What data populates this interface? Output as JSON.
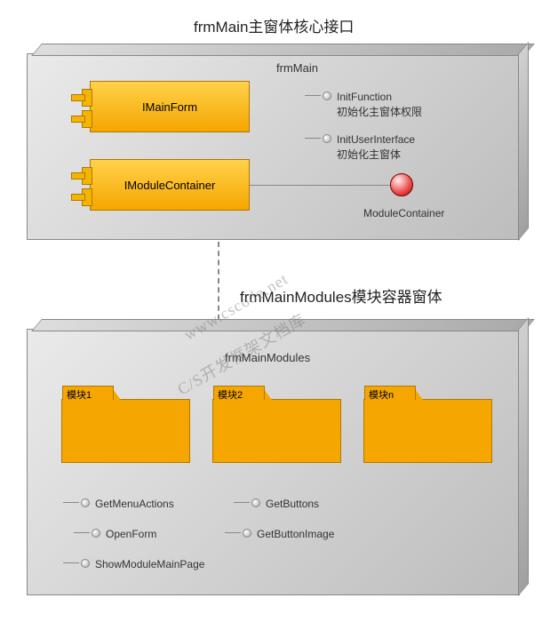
{
  "top": {
    "title": "frmMain主窗体核心接口",
    "subtitle": "frmMain",
    "components": [
      {
        "label": "IMainForm"
      },
      {
        "label": "IModuleContainer"
      }
    ],
    "pins": [
      {
        "name": "InitFunction",
        "desc": "初始化主窗体权限"
      },
      {
        "name": "InitUserInterface",
        "desc": "初始化主窗体"
      }
    ],
    "ball_label": "ModuleContainer"
  },
  "bottom": {
    "title": "frmMainModules模块容器窗体",
    "subtitle": "frmMainModules",
    "folders": [
      {
        "name": "模块1"
      },
      {
        "name": "模块2"
      },
      {
        "name": "模块n"
      }
    ],
    "pins_left": [
      "GetMenuActions",
      "OpenForm",
      "ShowModuleMainPage"
    ],
    "pins_right": [
      "GetButtons",
      "GetButtonImage"
    ]
  },
  "watermarks": {
    "line1": "www.cscode.net",
    "line2": "C/S开发框架文档库"
  }
}
